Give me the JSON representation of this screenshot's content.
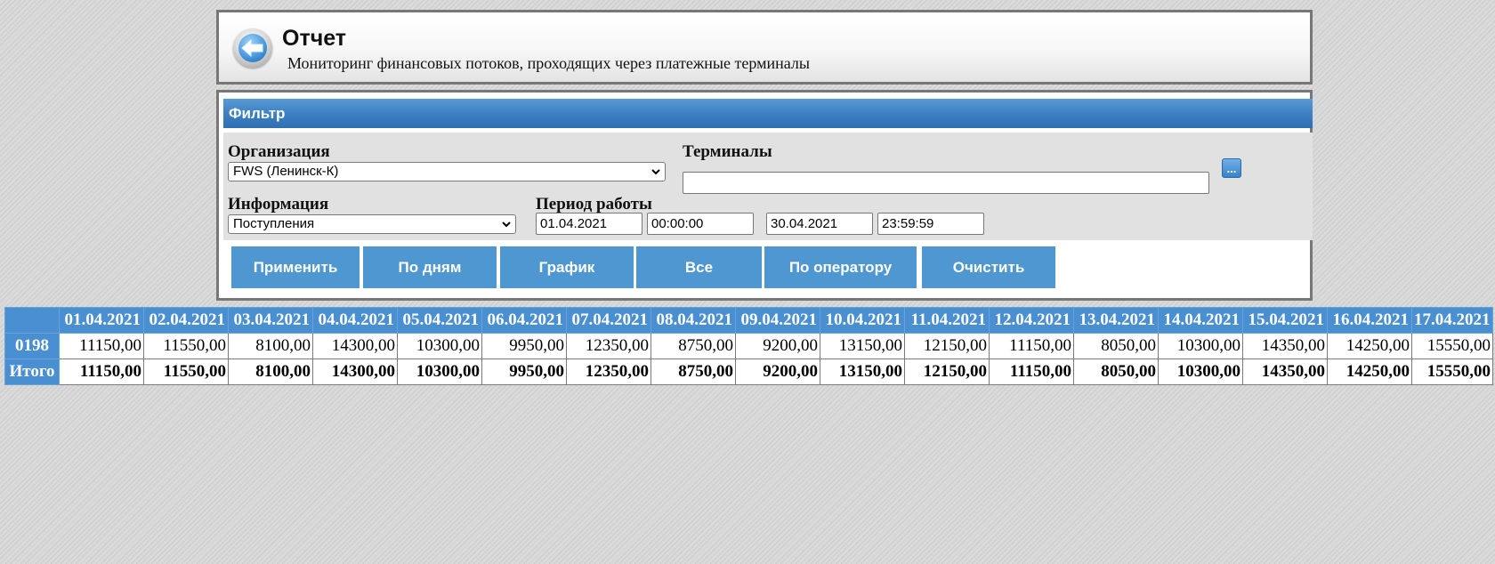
{
  "header": {
    "title": "Отчет",
    "subtitle": "Мониторинг финансовых потоков, проходящих через платежные терминалы"
  },
  "filter": {
    "title": "Фильтр",
    "organization_label": "Организация",
    "organization_value": "FWS (Ленинск-К)",
    "terminals_label": "Терминалы",
    "terminals_value": "",
    "terminals_button": "...",
    "info_label": "Информация",
    "info_value": "Поступления",
    "period_label": "Период работы",
    "date_from": "01.04.2021",
    "time_from": "00:00:00",
    "date_to": "30.04.2021",
    "time_to": "23:59:59"
  },
  "buttons": {
    "apply": "Применить",
    "by_days": "По дням",
    "chart": "График",
    "all": "Все",
    "by_operator": "По оператору",
    "clear": "Очистить"
  },
  "table": {
    "columns": [
      "01.04.2021",
      "02.04.2021",
      "03.04.2021",
      "04.04.2021",
      "05.04.2021",
      "06.04.2021",
      "07.04.2021",
      "08.04.2021",
      "09.04.2021",
      "10.04.2021",
      "11.04.2021",
      "12.04.2021",
      "13.04.2021",
      "14.04.2021",
      "15.04.2021",
      "16.04.2021",
      "17.04.2021"
    ],
    "rows": [
      {
        "label": "0198",
        "values": [
          "11150,00",
          "11550,00",
          "8100,00",
          "14300,00",
          "10300,00",
          "9950,00",
          "12350,00",
          "8750,00",
          "9200,00",
          "13150,00",
          "12150,00",
          "11150,00",
          "8050,00",
          "10300,00",
          "14350,00",
          "14250,00",
          "15550,00"
        ]
      },
      {
        "label": "Итого",
        "values": [
          "11150,00",
          "11550,00",
          "8100,00",
          "14300,00",
          "10300,00",
          "9950,00",
          "12350,00",
          "8750,00",
          "9200,00",
          "13150,00",
          "12150,00",
          "11150,00",
          "8050,00",
          "10300,00",
          "14350,00",
          "14250,00",
          "15550,00"
        ]
      }
    ]
  }
}
